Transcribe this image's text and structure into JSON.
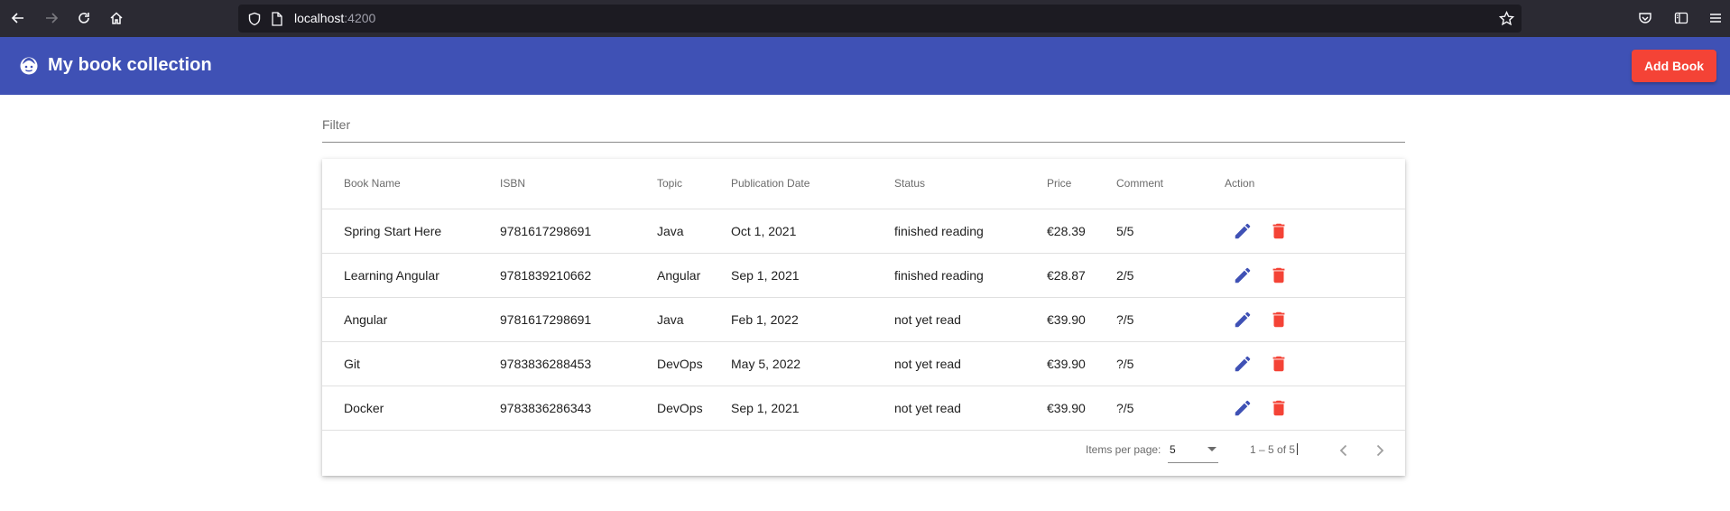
{
  "browser": {
    "url_host": "localhost",
    "url_port": ":4200"
  },
  "toolbar": {
    "title": "My book collection",
    "add_book_label": "Add Book"
  },
  "filter": {
    "placeholder": "Filter",
    "value": ""
  },
  "table": {
    "headers": [
      "Book Name",
      "ISBN",
      "Topic",
      "Publication Date",
      "Status",
      "Price",
      "Comment",
      "Action"
    ],
    "rows": [
      [
        "Spring Start Here",
        "9781617298691",
        "Java",
        "Oct 1, 2021",
        "finished reading",
        "€28.39",
        "5/5"
      ],
      [
        "Learning Angular",
        "9781839210662",
        "Angular",
        "Sep 1, 2021",
        "finished reading",
        "€28.87",
        "2/5"
      ],
      [
        "Angular",
        "9781617298691",
        "Java",
        "Feb 1, 2022",
        "not yet read",
        "€39.90",
        "?/5"
      ],
      [
        "Git",
        "9783836288453",
        "DevOps",
        "May 5, 2022",
        "not yet read",
        "€39.90",
        "?/5"
      ],
      [
        "Docker",
        "9783836286343",
        "DevOps",
        "Sep 1, 2021",
        "not yet read",
        "€39.90",
        "?/5"
      ]
    ]
  },
  "paginator": {
    "items_per_page_label": "Items per page:",
    "items_per_page_value": "5",
    "range_label": "1 – 5 of 5"
  },
  "colors": {
    "primary": "#3f51b5",
    "warn": "#f44336",
    "browser_bg": "#2b2a33"
  },
  "icons": {
    "edit": "pencil-icon",
    "delete": "trash-icon",
    "logo": "face-icon"
  }
}
